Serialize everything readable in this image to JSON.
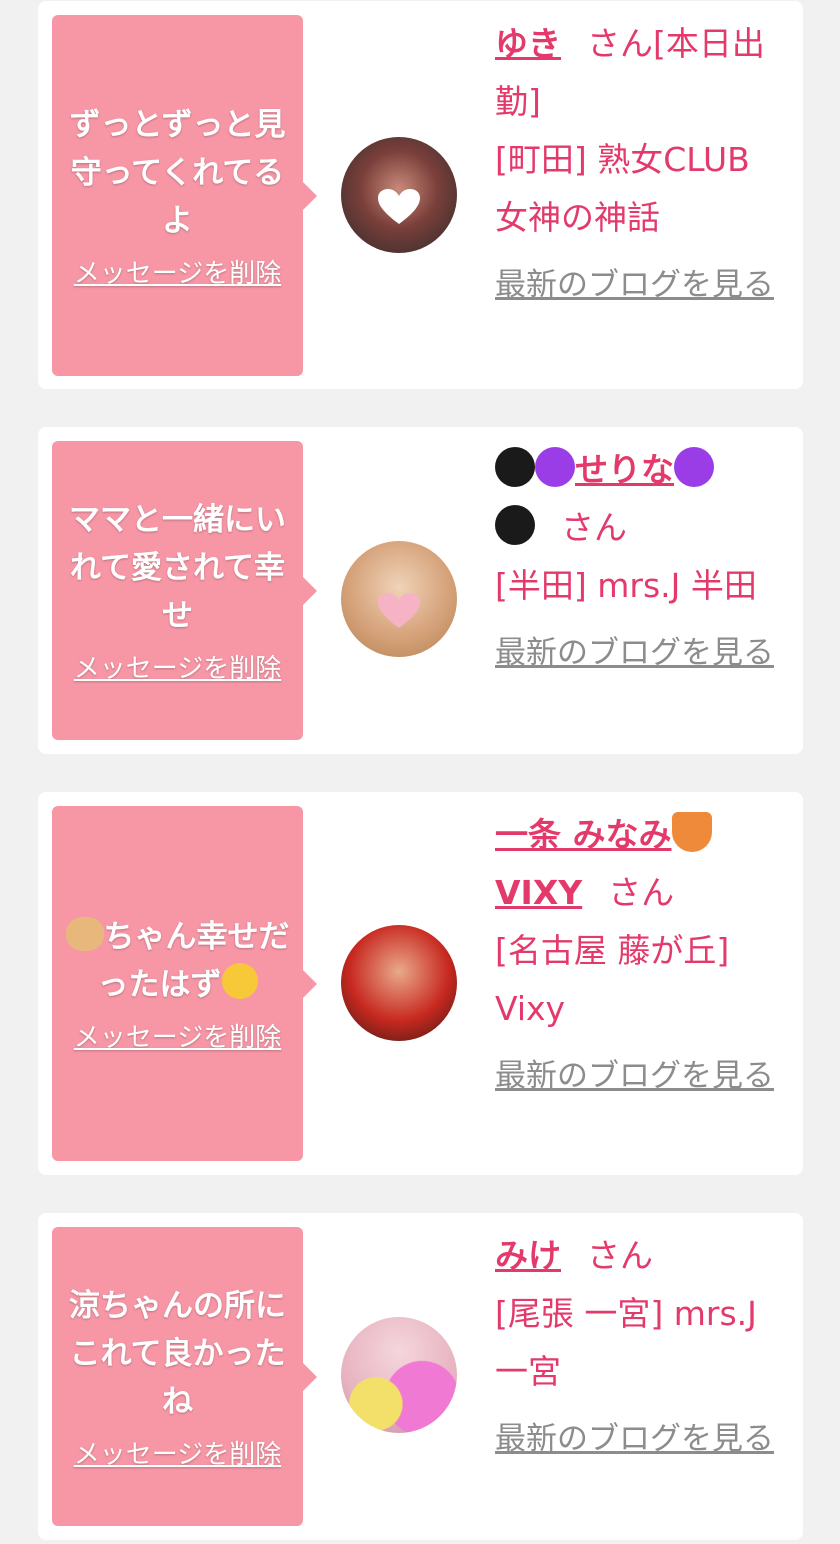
{
  "cards": [
    {
      "message": "ずっとずっと見守ってくれてるよ",
      "delete_label": "メッセージを削除",
      "name": "ゆき",
      "honorific": "さん",
      "status": "[本日出勤]",
      "shop": "[町田] 熟女CLUB 女神の神話",
      "blog_label": "最新のブログを見る"
    },
    {
      "message": "ママと一緒にいれて愛されて幸せ",
      "delete_label": "メッセージを削除",
      "name": "せりな",
      "honorific": "さん",
      "shop": "[半田] mrs.J 半田",
      "blog_label": "最新のブログを見る"
    },
    {
      "message_part1": "ちゃん幸せだったはず",
      "delete_label": "メッセージを削除",
      "name": "一条 みなみ",
      "name_suffix": "VIXY",
      "honorific": "さん",
      "shop": "[名古屋 藤が丘] Vixy",
      "blog_label": "最新のブログを見る"
    },
    {
      "message": "涼ちゃんの所にこれて良かったね",
      "delete_label": "メッセージを削除",
      "name": "みけ",
      "honorific": "さん",
      "shop": "[尾張 一宮] mrs.J 一宮",
      "blog_label": "最新のブログを見る"
    }
  ],
  "colors": {
    "background": "#f1f1f1",
    "bubble": "#f797a6",
    "accent_text": "#e33a6b",
    "link_gray": "#8c8c8c"
  },
  "icons": [
    "black-heart-icon",
    "purple-heart-icon",
    "fox-icon",
    "dog-icon",
    "smiling-face-icon",
    "white-heart-icon",
    "pink-heart-icon"
  ]
}
